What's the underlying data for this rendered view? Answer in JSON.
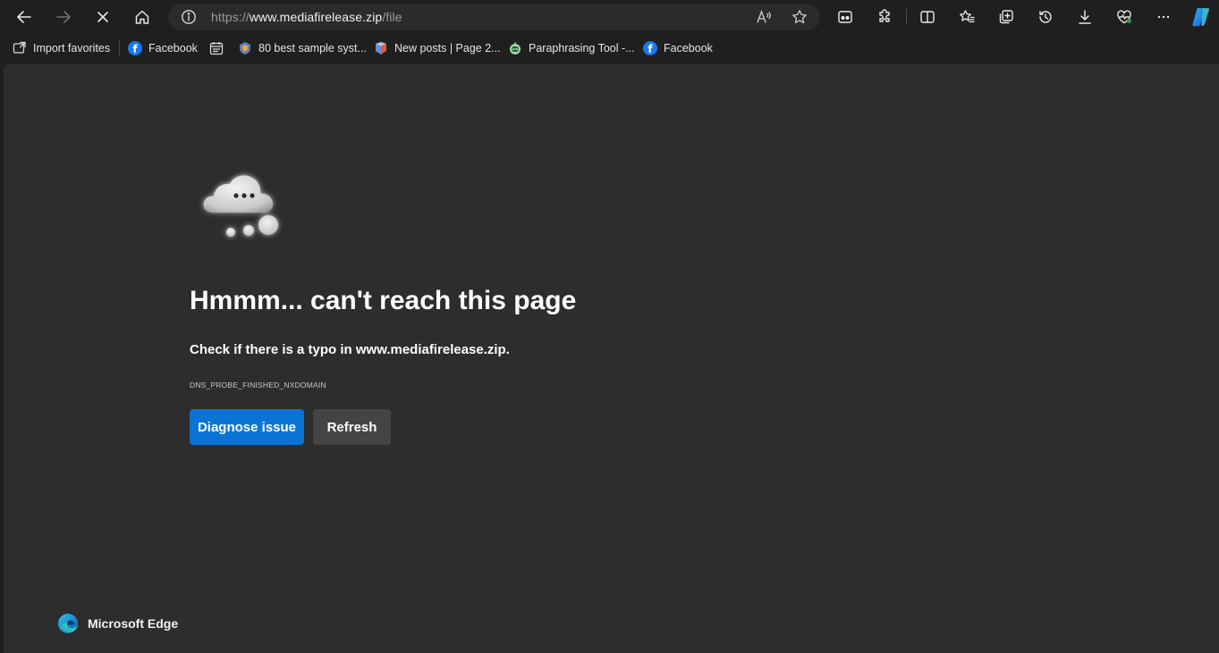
{
  "toolbar": {
    "address": {
      "scheme": "https://",
      "host": "www.mediafirelease.zip",
      "path": "/file"
    }
  },
  "favorites": [
    {
      "label": "Import favorites",
      "icon": "import-favorites-icon"
    },
    {
      "label": "Facebook",
      "icon": "facebook-icon"
    },
    {
      "label": "",
      "icon": "calendar-icon"
    },
    {
      "label": "80 best sample syst...",
      "icon": "site-icon"
    },
    {
      "label": "New posts | Page 2...",
      "icon": "site-icon"
    },
    {
      "label": "Paraphrasing Tool -...",
      "icon": "site-icon"
    },
    {
      "label": "Facebook",
      "icon": "facebook-icon"
    }
  ],
  "error_page": {
    "headline": "Hmmm... can't reach this page",
    "message": "Check if there is a typo in www.mediafirelease.zip.",
    "error_code": "DNS_PROBE_FINISHED_NXDOMAIN",
    "primary_button": "Diagnose issue",
    "secondary_button": "Refresh",
    "brand": "Microsoft Edge"
  },
  "colors": {
    "primary_button": "#0a74d4",
    "page_background": "#2d2d2d",
    "chrome_background": "#1f1f1f"
  }
}
